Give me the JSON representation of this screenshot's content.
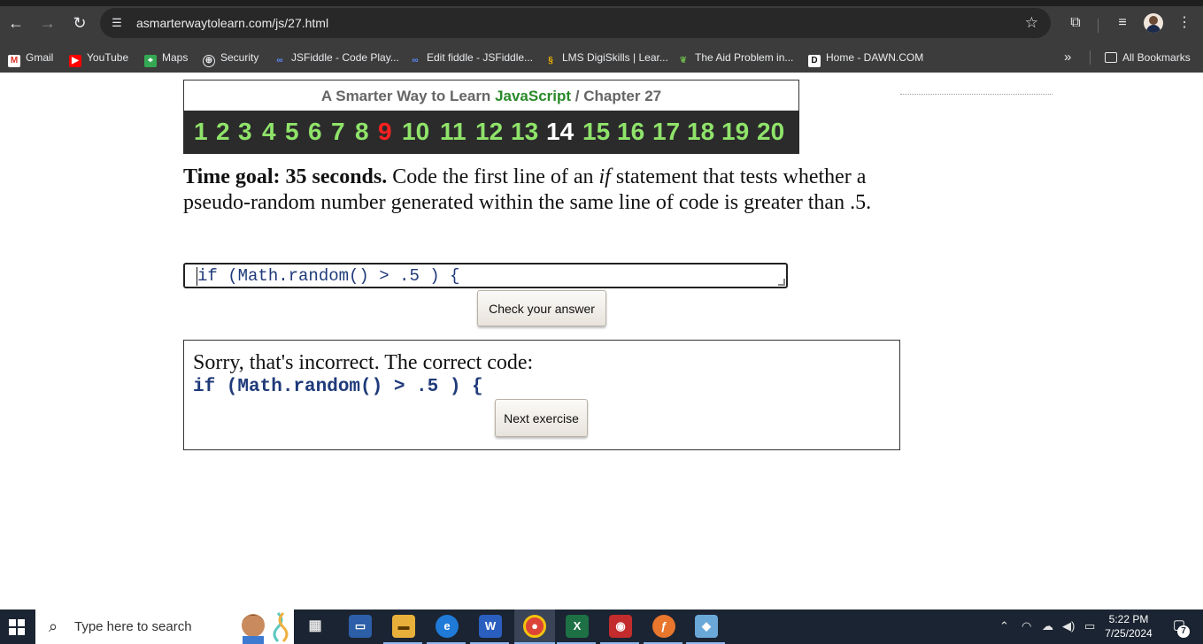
{
  "browser": {
    "url": "asmarterwaytolearn.com/js/27.html",
    "bookmarks": [
      {
        "label": "Gmail",
        "icon": "gmail-icon"
      },
      {
        "label": "YouTube",
        "icon": "youtube-icon"
      },
      {
        "label": "Maps",
        "icon": "maps-icon"
      },
      {
        "label": "Security",
        "icon": "globe-icon"
      },
      {
        "label": "JSFiddle - Code Play...",
        "icon": "jsfiddle-icon"
      },
      {
        "label": "Edit fiddle - JSFiddle...",
        "icon": "jsfiddle-icon"
      },
      {
        "label": "LMS DigiSkills | Lear...",
        "icon": "digiskills-icon"
      },
      {
        "label": "The Aid Problem in...",
        "icon": "leaf-icon"
      },
      {
        "label": "Home - DAWN.COM",
        "icon": "dawn-icon"
      }
    ],
    "more_label": "»",
    "all_bookmarks": "All Bookmarks"
  },
  "page": {
    "header_prefix": "A Smarter Way to Learn",
    "header_js": "JavaScript",
    "header_slash": "/",
    "header_chapter": "Chapter 27",
    "chapters": [
      "1",
      "2",
      "3",
      "4",
      "5",
      "6",
      "7",
      "8",
      "9",
      "10",
      "11",
      "12",
      "13",
      "14",
      "15",
      "16",
      "17",
      "18",
      "19",
      "20"
    ],
    "chapter_colors": {
      "default": "#8fe36a",
      "red": "#ff2020",
      "white": "#ffffff"
    },
    "instruction_bold": "Time goal: 35 seconds.",
    "instruction_1": " Code the first line of an ",
    "instruction_italic": "if",
    "instruction_2": " statement that tests whether a pseudo-random number generated within the same line of code is greater than .5.",
    "answer_value": "if (Math.random() > .5 ) {",
    "check_button": "Check your answer",
    "feedback_message": "Sorry, that's incorrect. The correct code:",
    "correct_code": "if (Math.random() > .5 ) {",
    "next_button": "Next exercise"
  },
  "taskbar": {
    "search_placeholder": "Type here to search",
    "time": "5:22 PM",
    "date": "7/25/2024",
    "notification_count": "7"
  }
}
